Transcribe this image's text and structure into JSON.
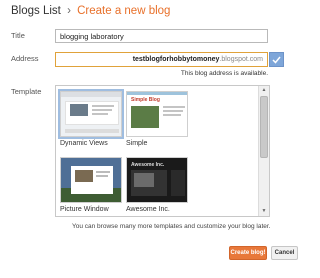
{
  "header": {
    "blogs_list": "Blogs List",
    "separator": "›",
    "title": "Create a new blog"
  },
  "form": {
    "title_label": "Title",
    "title_value": "blogging laboratory",
    "address_label": "Address",
    "address_subdomain": "testblogforhobbytomoney",
    "address_domain": ".blogspot.com",
    "address_status": "This blog address is available.",
    "template_label": "Template"
  },
  "templates": [
    {
      "name": "Dynamic Views",
      "selected": true
    },
    {
      "name": "Simple",
      "selected": false
    },
    {
      "name": "Picture Window",
      "selected": false
    },
    {
      "name": "Awesome Inc.",
      "selected": false
    }
  ],
  "thumb_texts": {
    "simple_heading": "Simple Blog",
    "awesome_heading": "Awesome Inc."
  },
  "hint": "You can browse many more templates and customize your blog later.",
  "buttons": {
    "create": "Create blog!",
    "cancel": "Cancel"
  },
  "colors": {
    "accent": "#e8702a",
    "check": "#7ea6d9"
  },
  "icons": {
    "address_check": "checkmark-icon",
    "scroll_up": "up-arrow-icon",
    "scroll_down": "down-arrow-icon"
  }
}
